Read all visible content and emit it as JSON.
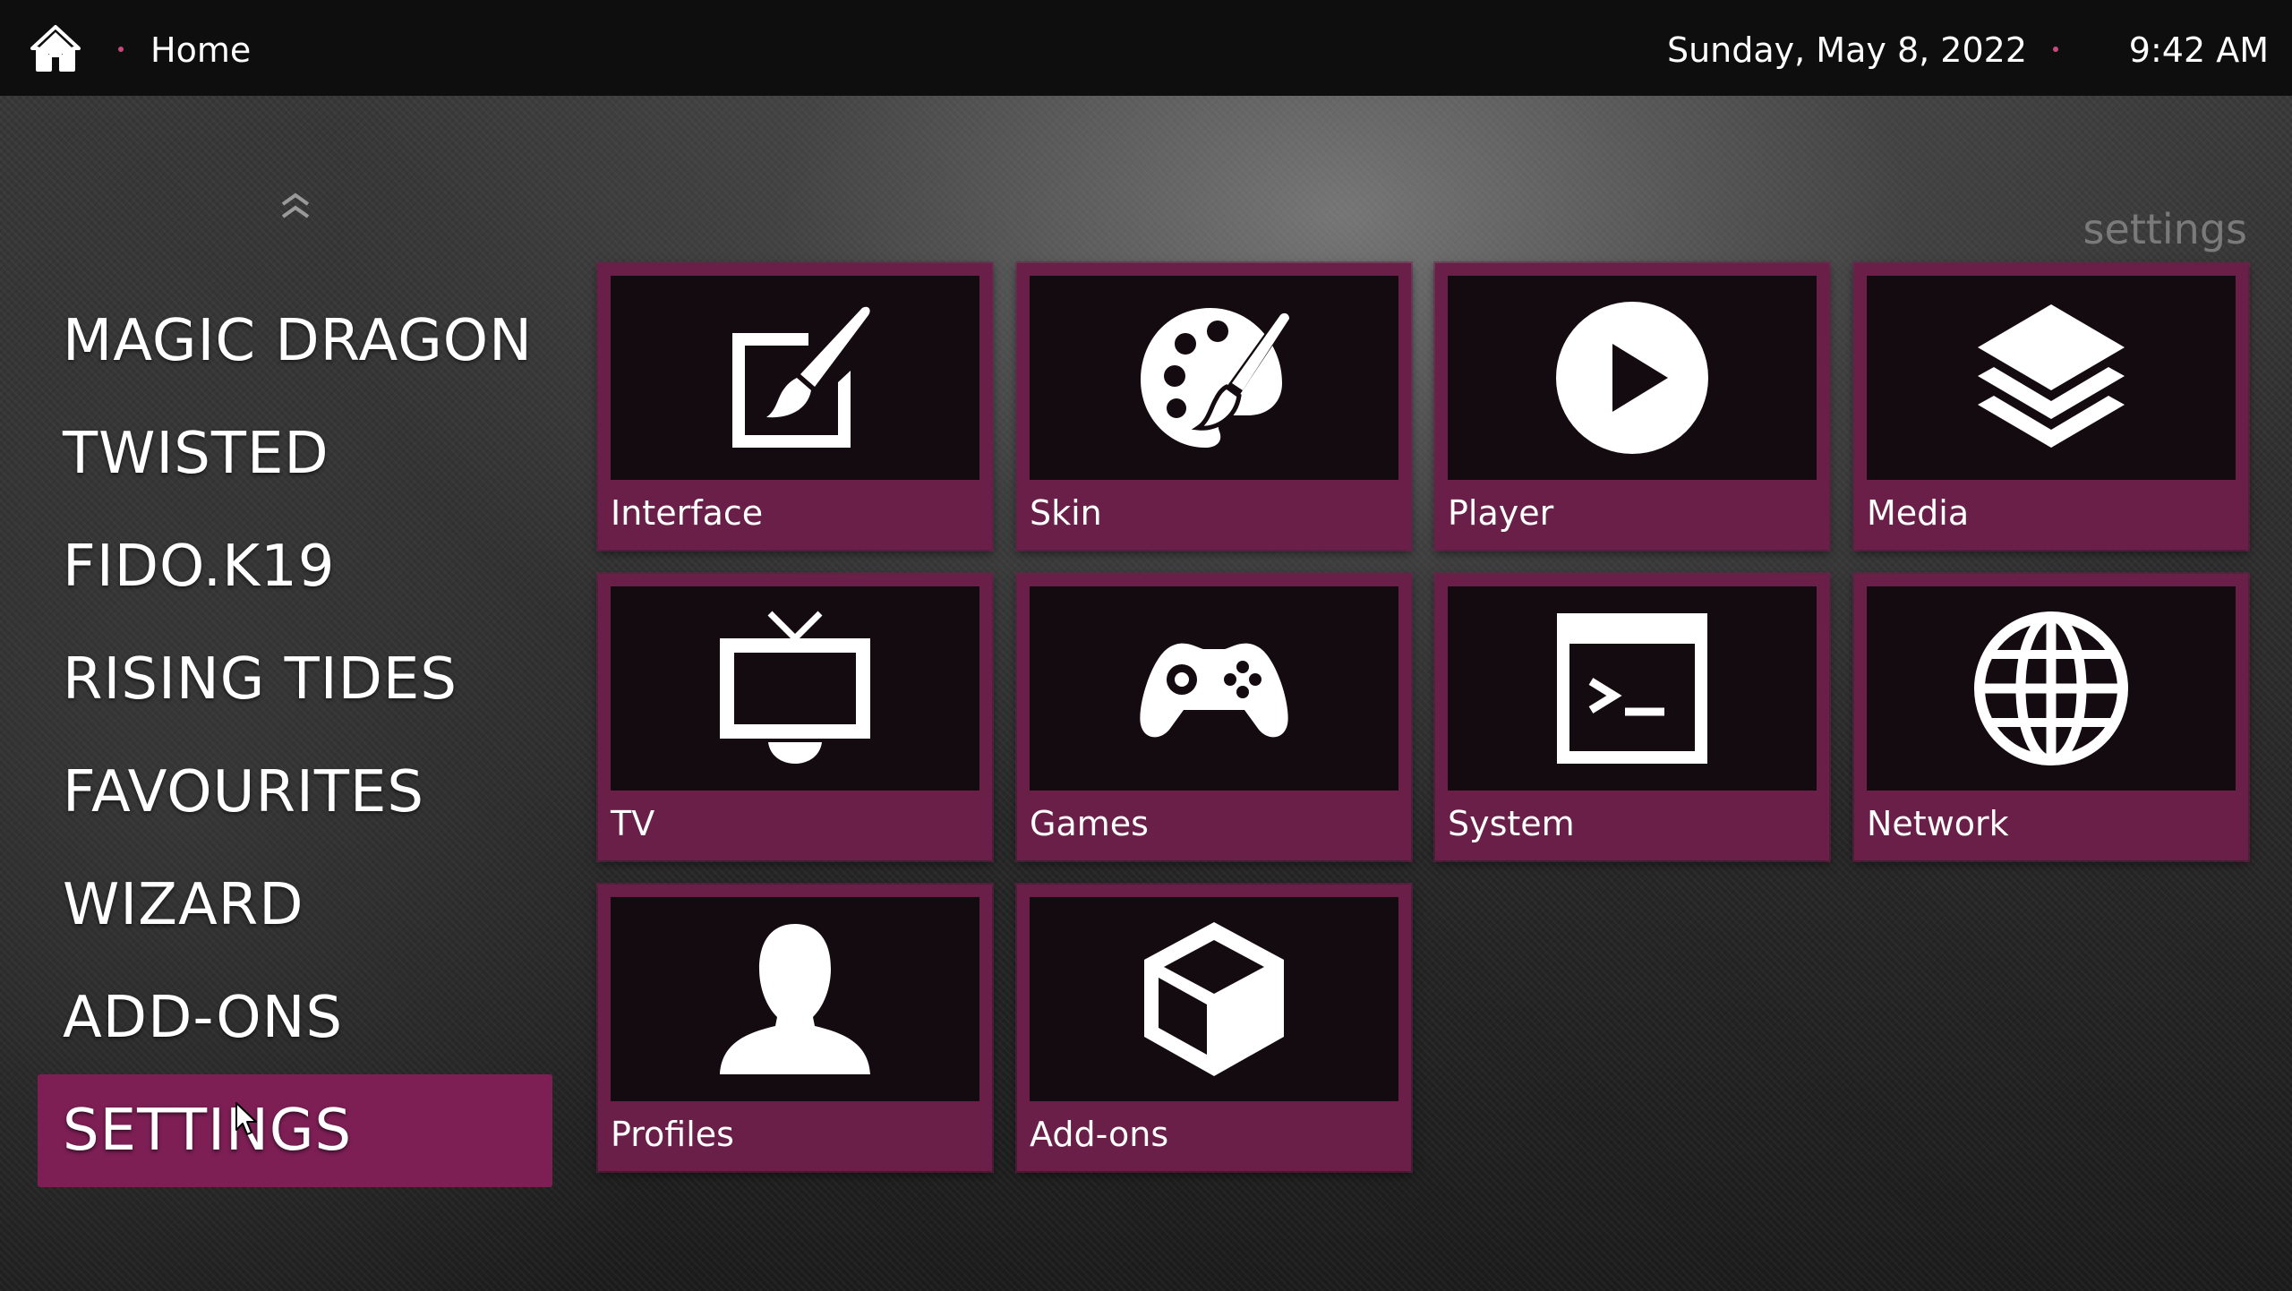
{
  "topbar": {
    "home_icon": "home-icon",
    "breadcrumb": "Home",
    "date": "Sunday, May 8, 2022",
    "time": "9:42 AM",
    "accent_color": "#c84a7c"
  },
  "sidebar": {
    "scroll_up_icon": "double-chevron-up-icon",
    "items": [
      {
        "label": "MAGIC DRAGON",
        "active": false
      },
      {
        "label": "TWISTED",
        "active": false
      },
      {
        "label": "FIDO.K19",
        "active": false
      },
      {
        "label": "RISING TIDES",
        "active": false
      },
      {
        "label": "FAVOURITES",
        "active": false
      },
      {
        "label": "WIZARD",
        "active": false
      },
      {
        "label": "ADD-ONS",
        "active": false
      },
      {
        "label": "SETTINGS",
        "active": true
      }
    ],
    "active_color": "#7d1f55"
  },
  "main": {
    "section_title": "settings",
    "tile_frame_color": "#6a1f48",
    "tiles": [
      {
        "label": "Interface",
        "icon": "paint-canvas-icon"
      },
      {
        "label": "Skin",
        "icon": "palette-icon"
      },
      {
        "label": "Player",
        "icon": "play-circle-icon"
      },
      {
        "label": "Media",
        "icon": "layers-icon"
      },
      {
        "label": "TV",
        "icon": "tv-icon"
      },
      {
        "label": "Games",
        "icon": "gamepad-icon"
      },
      {
        "label": "System",
        "icon": "terminal-icon"
      },
      {
        "label": "Network",
        "icon": "globe-icon"
      },
      {
        "label": "Profiles",
        "icon": "user-icon"
      },
      {
        "label": "Add-ons",
        "icon": "box-icon"
      }
    ]
  }
}
